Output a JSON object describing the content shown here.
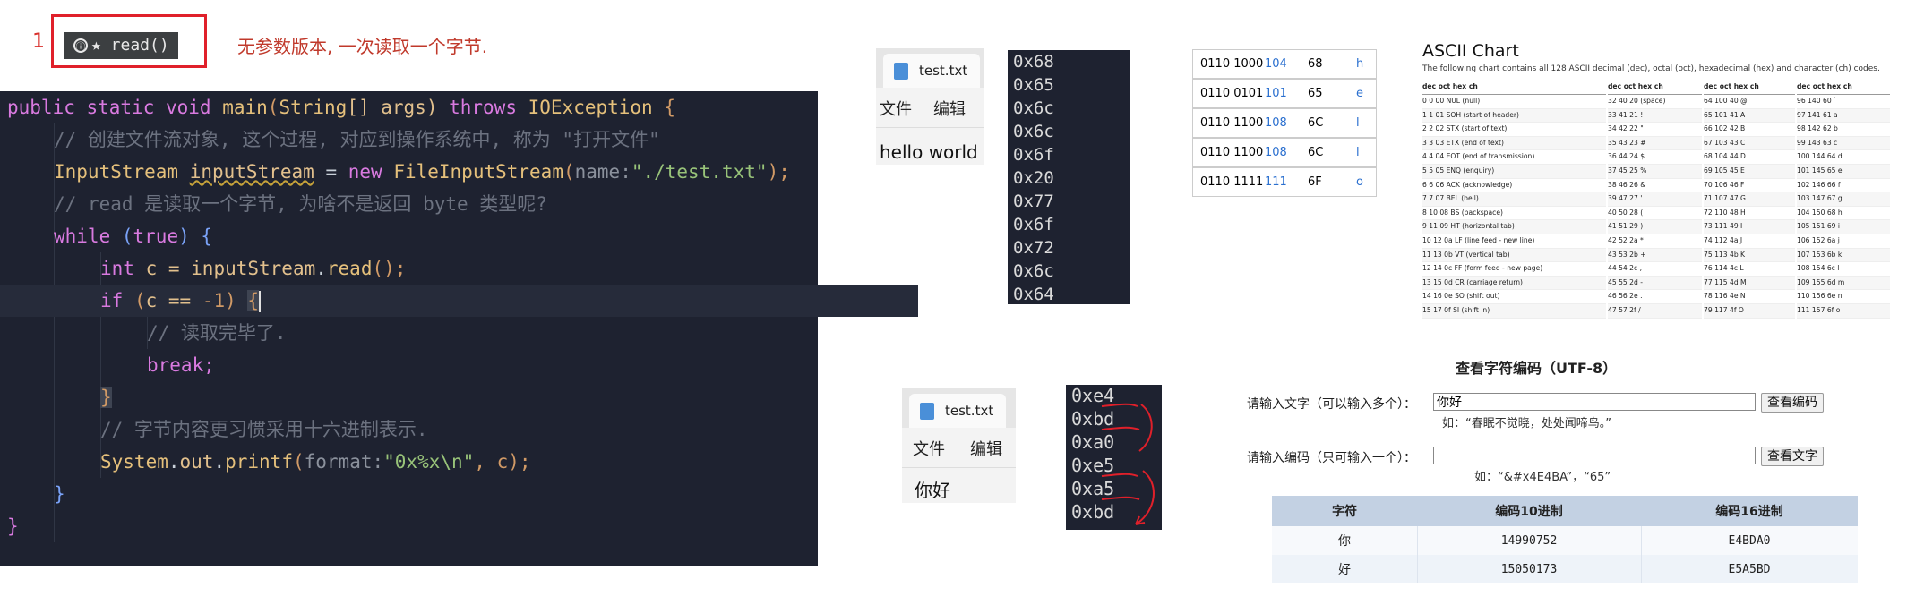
{
  "annotation": {
    "number": "1",
    "method_icon": "ⓘ",
    "method_label": "★ read()",
    "description": "无参数版本, 一次读取一个字节."
  },
  "code": {
    "line1": {
      "p1": "public static void ",
      "p2": "main",
      "p3": "(",
      "p4": "String",
      "p5": "[] args) ",
      "p6": "throws ",
      "p7": "IOException",
      "p8": " {"
    },
    "line2": "// 创建文件流对象, 这个过程, 对应到操作系统中, 称为 \"打开文件\"",
    "line3": {
      "p1": "InputStream ",
      "p2": "inputStream",
      "p3": " = ",
      "p4": "new ",
      "p5": "FileInputStream",
      "p6": "(",
      "p7": "name:",
      "p8": "\"./test.txt\"",
      "p9": ");"
    },
    "line4": "// read 是读取一个字节, 为啥不是返回 byte 类型呢?",
    "line5": {
      "p1": "while ",
      "p2": "(",
      "p3": "true",
      "p4": ") {"
    },
    "line6": {
      "p1": "int ",
      "p2": "c = ",
      "p3": "inputStream",
      "p4": ".",
      "p5": "read",
      "p6": "();"
    },
    "line7": {
      "p1": "if ",
      "p2": "(",
      "p3": "c == ",
      "p4": "-1",
      "p5": ") ",
      "p6": "{"
    },
    "line8": "// 读取完毕了.",
    "line9": "break;",
    "line10": "}",
    "line11": "// 字节内容更习惯采用十六进制表示.",
    "line12": {
      "p1": "System",
      "p2": ".",
      "p3": "out",
      "p4": ".",
      "p5": "printf",
      "p6": "(",
      "p7": "format:",
      "p8": "\"0x%x\\n\"",
      "p9": ", c);"
    },
    "line13": "}",
    "line14": "}"
  },
  "file_window_1": {
    "tab": "test.txt",
    "menu_file": "文件",
    "menu_edit": "编辑",
    "content": "hello world"
  },
  "file_window_2": {
    "tab": "test.txt",
    "menu_file": "文件",
    "menu_edit": "编辑",
    "content": "你好"
  },
  "hex_output_1": [
    "0x68",
    "0x65",
    "0x6c",
    "0x6c",
    "0x6f",
    "0x20",
    "0x77",
    "0x6f",
    "0x72",
    "0x6c",
    "0x64"
  ],
  "hex_output_2": [
    "0xe4",
    "0xbd",
    "0xa0",
    "0xe5",
    "0xa5",
    "0xbd"
  ],
  "binary_table": [
    {
      "bin": "0110 1000",
      "dec": "104",
      "hex": "68",
      "ch": "h"
    },
    {
      "bin": "0110 0101",
      "dec": "101",
      "hex": "65",
      "ch": "e"
    },
    {
      "bin": "0110 1100",
      "dec": "108",
      "hex": "6C",
      "ch": "l"
    },
    {
      "bin": "0110 1100",
      "dec": "108",
      "hex": "6C",
      "ch": "l"
    },
    {
      "bin": "0110 1111",
      "dec": "111",
      "hex": "6F",
      "ch": "o"
    }
  ],
  "ascii_chart": {
    "title": "ASCII Chart",
    "subtitle": "The following chart contains all 128 ASCII decimal (dec), octal (oct), hexadecimal (hex) and character (ch) codes.",
    "headers": [
      "dec",
      "oct",
      "hex",
      "ch"
    ],
    "col1": [
      "0 0 00 NUL (null)",
      "1 1 01 SOH (start of header)",
      "2 2 02 STX (start of text)",
      "3 3 03 ETX (end of text)",
      "4 4 04 EOT (end of transmission)",
      "5 5 05 ENQ (enquiry)",
      "6 6 06 ACK (acknowledge)",
      "7 7 07 BEL (bell)",
      "8 10 08 BS (backspace)",
      "9 11 09 HT (horizontal tab)",
      "10 12 0a LF (line feed - new line)",
      "11 13 0b VT (vertical tab)",
      "12 14 0c FF (form feed - new page)",
      "13 15 0d CR (carriage return)",
      "14 16 0e SO (shift out)",
      "15 17 0f SI (shift in)"
    ],
    "col2": [
      "32 40 20 (space)",
      "33 41 21 !",
      "34 42 22 \"",
      "35 43 23 #",
      "36 44 24 $",
      "37 45 25 %",
      "38 46 26 &",
      "39 47 27 '",
      "40 50 28 (",
      "41 51 29 )",
      "42 52 2a *",
      "43 53 2b +",
      "44 54 2c ,",
      "45 55 2d -",
      "46 56 2e .",
      "47 57 2f /"
    ],
    "col3": [
      "64 100 40 @",
      "65 101 41 A",
      "66 102 42 B",
      "67 103 43 C",
      "68 104 44 D",
      "69 105 45 E",
      "70 106 46 F",
      "71 107 47 G",
      "72 110 48 H",
      "73 111 49 I",
      "74 112 4a J",
      "75 113 4b K",
      "76 114 4c L",
      "77 115 4d M",
      "78 116 4e N",
      "79 117 4f O"
    ],
    "col4": [
      "96 140 60 `",
      "97 141 61 a",
      "98 142 62 b",
      "99 143 63 c",
      "100 144 64 d",
      "101 145 65 e",
      "102 146 66 f",
      "103 147 67 g",
      "104 150 68 h",
      "105 151 69 i",
      "106 152 6a j",
      "107 153 6b k",
      "108 154 6c l",
      "109 155 6d m",
      "110 156 6e n",
      "111 157 6f o"
    ]
  },
  "encoding_lookup": {
    "title": "查看字符编码（UTF-8）",
    "text_label": "请输入文字（可以输入多个）：",
    "text_value": "你好",
    "text_button": "查看编码",
    "text_hint": "如：“春眠不觉晓，处处闻啼鸟。”",
    "code_label": "请输入编码（只可输入一个）：",
    "code_value": "",
    "code_button": "查看文字",
    "code_hint": "如：“&#x4E4BA”，“65”",
    "table_headers": [
      "字符",
      "编码10进制",
      "编码16进制"
    ],
    "rows": [
      {
        "char": "你",
        "dec": "14990752",
        "hex": "E4BDA0"
      },
      {
        "char": "好",
        "dec": "15050173",
        "hex": "E5A5BD"
      }
    ]
  },
  "colors": {
    "editor_bg": "#1e2230",
    "annotation_red": "#e0202a",
    "table_header": "#c3d1e3"
  }
}
